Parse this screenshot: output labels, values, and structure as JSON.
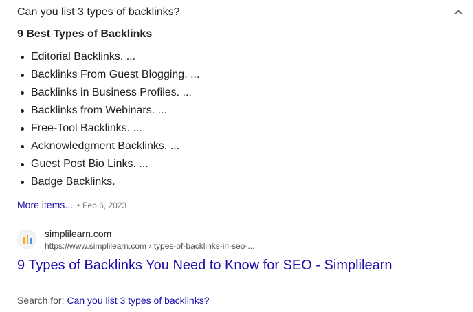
{
  "question": {
    "text": "Can you list 3 types of backlinks?",
    "toggle_icon": "chevron-up-icon"
  },
  "answer": {
    "heading": "9 Best Types of Backlinks",
    "items": [
      "Editorial Backlinks. ...",
      "Backlinks From Guest Blogging. ...",
      "Backlinks in Business Profiles. ...",
      "Backlinks from Webinars. ...",
      "Free-Tool Backlinks. ...",
      "Acknowledgment Backlinks. ...",
      "Guest Post Bio Links. ...",
      "Badge Backlinks."
    ],
    "more_label": "More items...",
    "separator": "•",
    "date": "Feb 6, 2023"
  },
  "source": {
    "site_name": "simplilearn.com",
    "url": "https://www.simplilearn.com › types-of-backlinks-in-seo-...",
    "favicon_icon": "simplilearn-favicon-icon",
    "title": "9 Types of Backlinks You Need to Know for SEO - Simplilearn"
  },
  "search_for": {
    "label": "Search for:",
    "query": "Can you list 3 types of backlinks?"
  },
  "colors": {
    "link": "#1a0dab",
    "text": "#202124",
    "muted": "#70757a",
    "favicon_accent": "#f5a623"
  }
}
